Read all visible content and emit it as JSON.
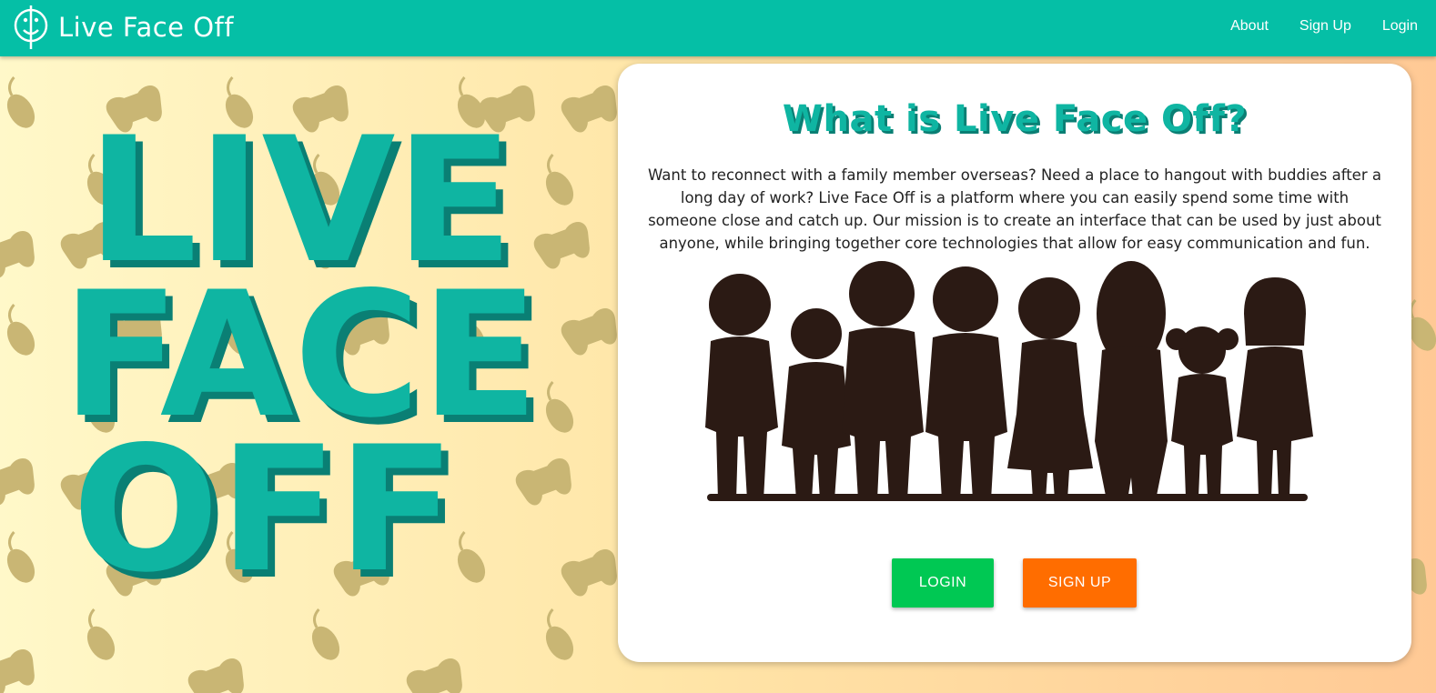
{
  "navbar": {
    "brand_name": "Live Face Off",
    "links": [
      {
        "label": "About"
      },
      {
        "label": "Sign Up"
      },
      {
        "label": "Login"
      }
    ],
    "background_color": "#05bfa6"
  },
  "hero": {
    "lines": [
      "LIVE",
      "FACE",
      "OFF"
    ],
    "text_color": "#0fb5a2",
    "shadow_color": "#0a7f74"
  },
  "card": {
    "title": "What is Live Face Off?",
    "description": "Want to reconnect with a family member overseas? Need a place to hangout with buddies after a long day of work? Live Face Off is a platform where you can easily spend some time with someone close and catch up. Our mission is to create an interface that can be used by just about anyone, while bringing together core technologies that allow for easy communication and fun.",
    "image": "family-silhouette",
    "buttons": {
      "login": "LOGIN",
      "signup": "SIGN UP"
    },
    "login_color": "#00c853",
    "signup_color": "#ff6d00"
  },
  "background": {
    "pattern_icons": [
      "gamepad-icon",
      "mouse-icon"
    ],
    "gradient_colors": [
      "#fff8c9",
      "#ffc995"
    ]
  }
}
